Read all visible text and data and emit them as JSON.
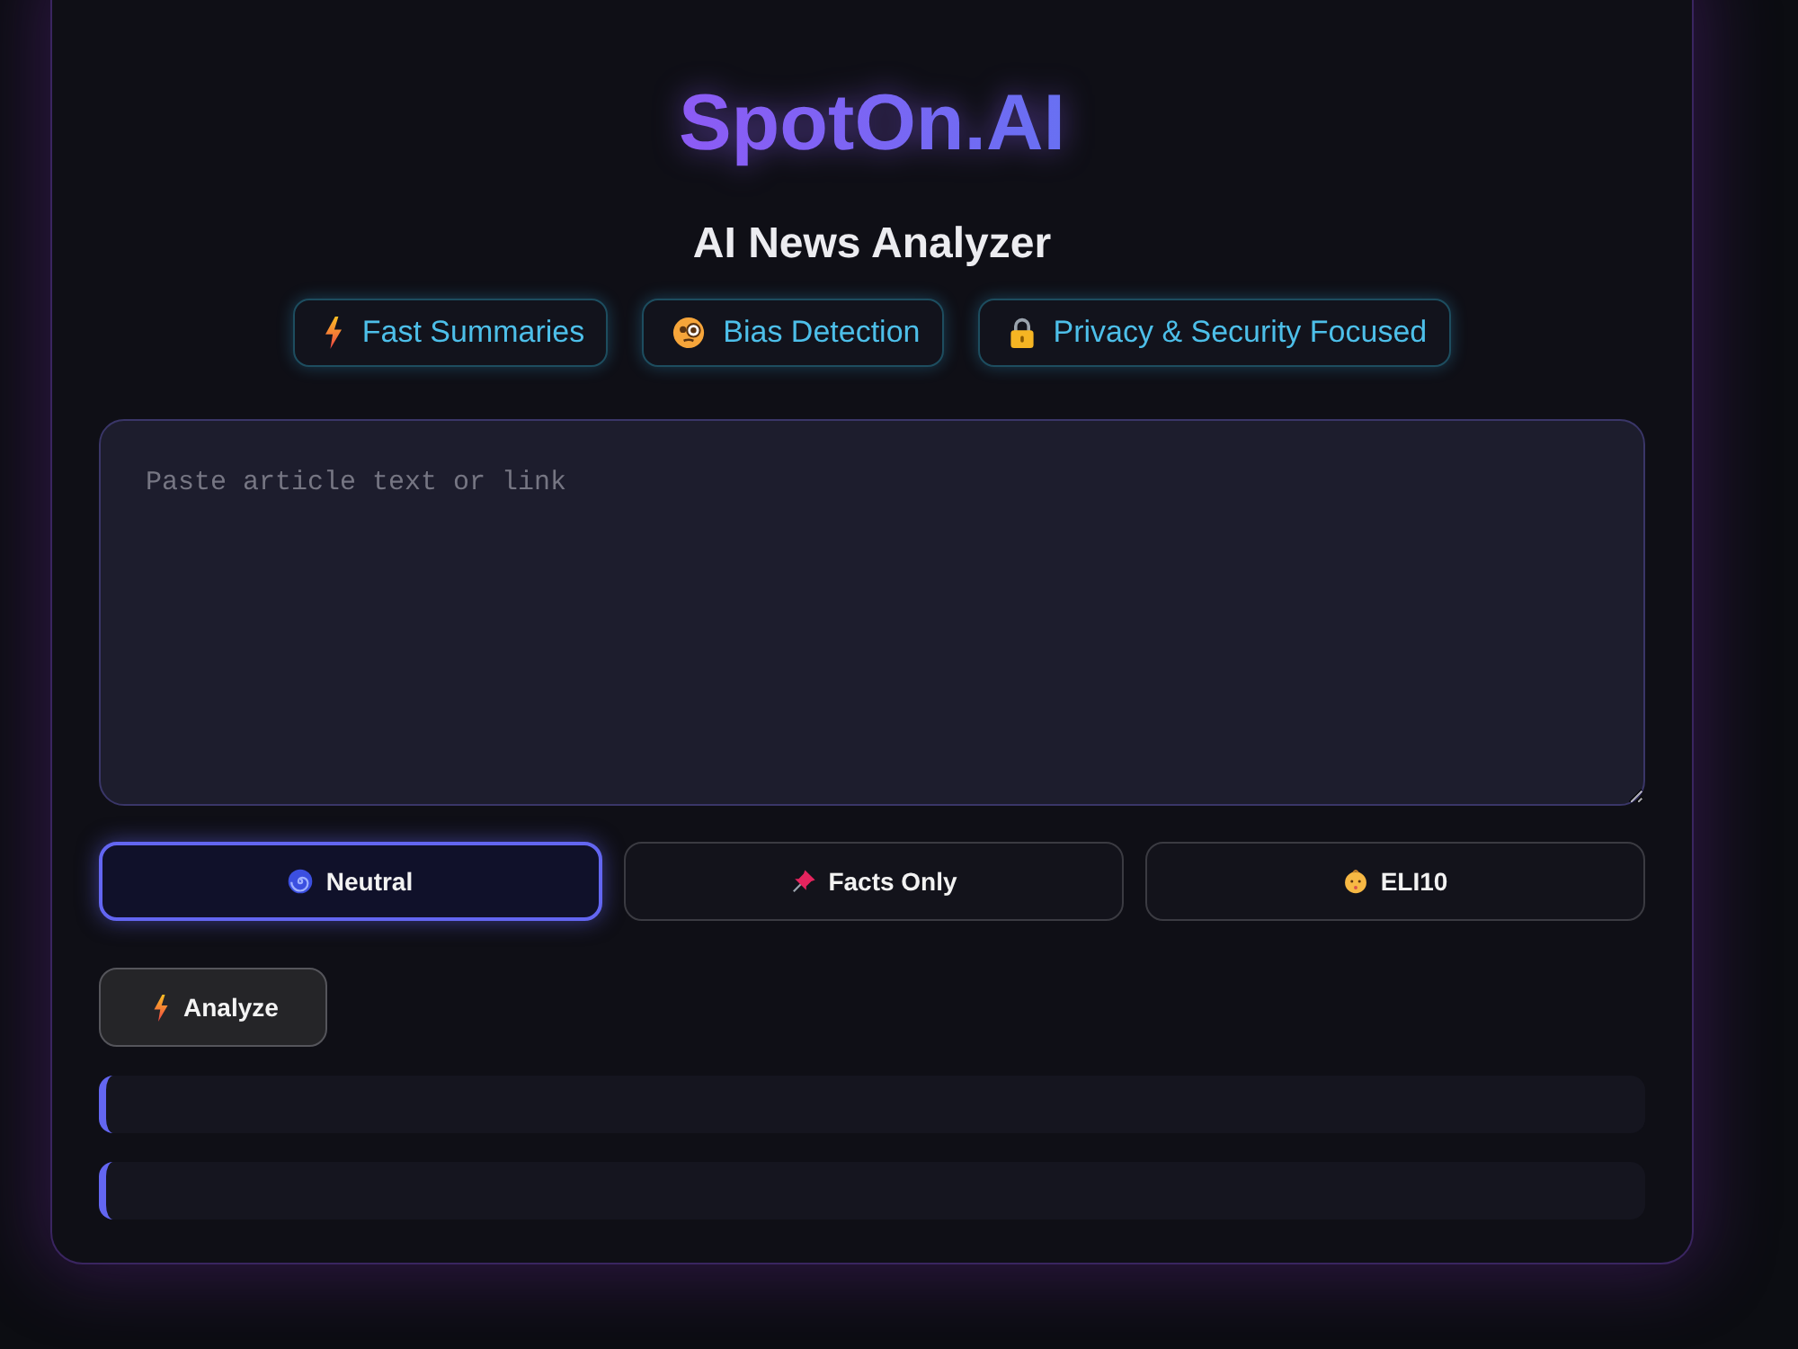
{
  "header": {
    "title": "SpotOn.AI",
    "subtitle": "AI News Analyzer"
  },
  "features": [
    {
      "label": "Fast Summaries"
    },
    {
      "label": "Bias Detection"
    },
    {
      "label": "Privacy & Security Focused"
    }
  ],
  "article_input": {
    "placeholder": "Paste article text or link"
  },
  "modes": [
    {
      "label": "Neutral",
      "selected": true
    },
    {
      "label": "Facts Only",
      "selected": false
    },
    {
      "label": "ELI10",
      "selected": false
    }
  ],
  "analyze_button": {
    "label": "Analyze"
  }
}
